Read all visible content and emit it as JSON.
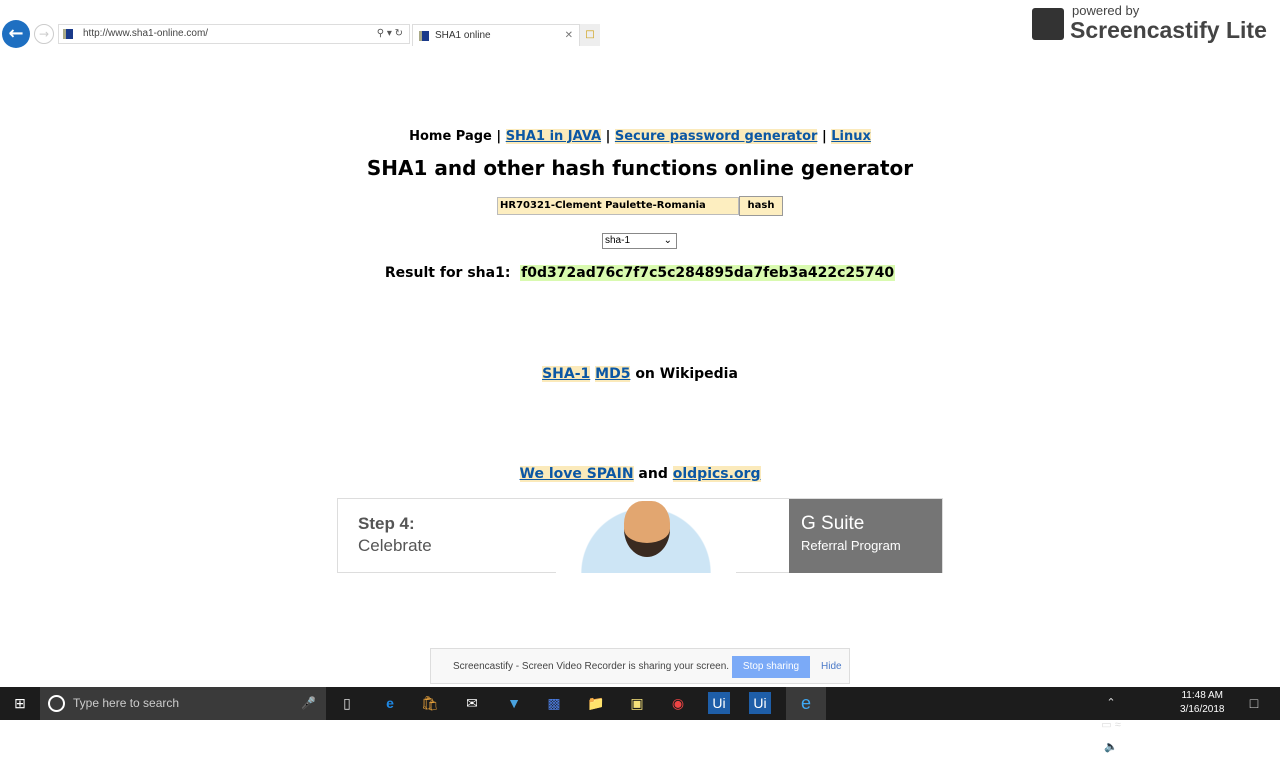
{
  "browser": {
    "url": "http://www.sha1-online.com/",
    "tab_title": "SHA1 online"
  },
  "overlay": {
    "powered_by": "powered by",
    "brand": "Screencastify Lite"
  },
  "nav": {
    "home": "Home Page",
    "sep": "|",
    "java": "SHA1 in JAVA",
    "password": "Secure password generator",
    "linux": "Linux"
  },
  "page": {
    "title": "SHA1 and other hash functions online generator",
    "input_value": "HR70321-Clement Paulette-Romania",
    "hash_button": "hash",
    "algorithm": "sha-1",
    "result_label": "Result for sha1:",
    "result_value": "f0d372ad76c7f7c5c284895da7feb3a422c25740",
    "wiki_sha1": "SHA-1",
    "wiki_md5": "MD5",
    "wiki_suffix": "on Wikipedia",
    "spain": "We love SPAIN",
    "and": "and",
    "oldpics": "oldpics.org"
  },
  "ad": {
    "step": "Step 4:",
    "step_text": "Celebrate",
    "brand": "G Suite",
    "program": "Referral Program"
  },
  "share_bar": {
    "message": "Screencastify - Screen Video Recorder is sharing your screen.",
    "stop": "Stop sharing",
    "hide": "Hide"
  },
  "taskbar": {
    "search_placeholder": "Type here to search",
    "time": "11:48 AM",
    "date": "3/16/2018",
    "app_ui": "Ui"
  }
}
